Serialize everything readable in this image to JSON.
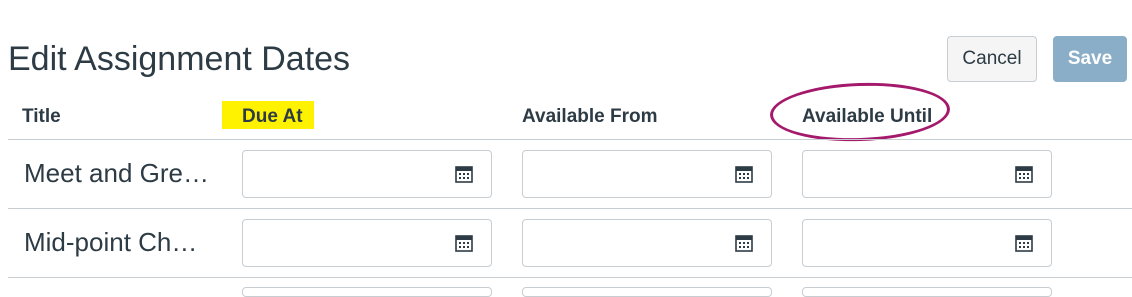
{
  "header": {
    "title": "Edit Assignment Dates",
    "cancel_label": "Cancel",
    "save_label": "Save"
  },
  "columns": {
    "title": "Title",
    "due_at": "Due At",
    "available_from": "Available From",
    "available_until": "Available Until"
  },
  "rows": [
    {
      "title": "Meet and Gre…",
      "due_at": "",
      "available_from": "",
      "available_until": ""
    },
    {
      "title": "Mid-point Ch…",
      "due_at": "",
      "available_from": "",
      "available_until": ""
    }
  ],
  "icons": {
    "date_picker": "calendar-icon"
  },
  "colors": {
    "highlight": "#fff200",
    "annotation_circle": "#a4196b",
    "save_button": "#8aaec8"
  }
}
